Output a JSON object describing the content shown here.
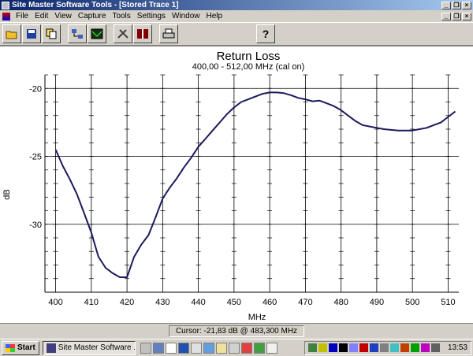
{
  "window": {
    "title": "Site Master Software Tools - [Stored Trace 1]",
    "minimize_glyph": "_",
    "restore_glyph": "❐",
    "close_glyph": "×"
  },
  "menu": {
    "items": [
      "File",
      "Edit",
      "View",
      "Capture",
      "Tools",
      "Settings",
      "Window",
      "Help"
    ]
  },
  "toolbar": {
    "buttons": [
      "open-icon",
      "save-icon",
      "copy-icon",
      "capture-icon",
      "display-icon",
      "tools-icon",
      "signal-icon",
      "print-icon",
      "help-icon"
    ],
    "help_label": "?"
  },
  "chart_data": {
    "type": "line",
    "title": "Return Loss",
    "subtitle": "400,00 - 512,00 MHz (cal on)",
    "xlabel": "MHz",
    "ylabel": "dB",
    "xlim": [
      397,
      513
    ],
    "ylim": [
      -35,
      -19
    ],
    "x_ticks": [
      400,
      410,
      420,
      430,
      440,
      450,
      460,
      470,
      480,
      490,
      500,
      510
    ],
    "y_ticks": [
      -20,
      -25,
      -30
    ],
    "y_minor_step": 1,
    "grid": true,
    "line_color": "#1a1a5c",
    "series": [
      {
        "x": [
          400,
          402,
          404,
          406,
          408,
          410,
          412,
          414,
          416,
          418,
          420,
          422,
          424,
          426,
          428,
          430,
          432,
          434,
          436,
          438,
          440,
          442,
          444,
          446,
          448,
          450,
          452,
          454,
          456,
          458,
          460,
          462,
          464,
          466,
          468,
          470,
          472,
          474,
          476,
          478,
          480,
          482,
          484,
          486,
          488,
          490,
          492,
          494,
          496,
          498,
          500,
          502,
          504,
          506,
          508,
          510,
          512
        ],
        "y": [
          -24.5,
          -25.7,
          -26.7,
          -27.8,
          -29.2,
          -30.6,
          -32.4,
          -33.2,
          -33.6,
          -33.9,
          -33.9,
          -32.4,
          -31.5,
          -30.8,
          -29.5,
          -28.1,
          -27.3,
          -26.6,
          -25.8,
          -25.1,
          -24.3,
          -23.7,
          -23.1,
          -22.5,
          -21.9,
          -21.4,
          -21.0,
          -20.8,
          -20.6,
          -20.4,
          -20.3,
          -20.3,
          -20.35,
          -20.5,
          -20.7,
          -20.8,
          -20.95,
          -20.9,
          -21.1,
          -21.3,
          -21.6,
          -22.0,
          -22.4,
          -22.7,
          -22.8,
          -22.9,
          -23.0,
          -23.05,
          -23.1,
          -23.1,
          -23.1,
          -23.0,
          -22.9,
          -22.7,
          -22.5,
          -22.1,
          -21.7
        ]
      }
    ]
  },
  "status": {
    "cursor_text": "Cursor:   -21,83 dB @ 483,300 MHz"
  },
  "taskbar": {
    "start_label": "Start",
    "active_task": "Site Master Software ...",
    "clock": "13:53"
  }
}
